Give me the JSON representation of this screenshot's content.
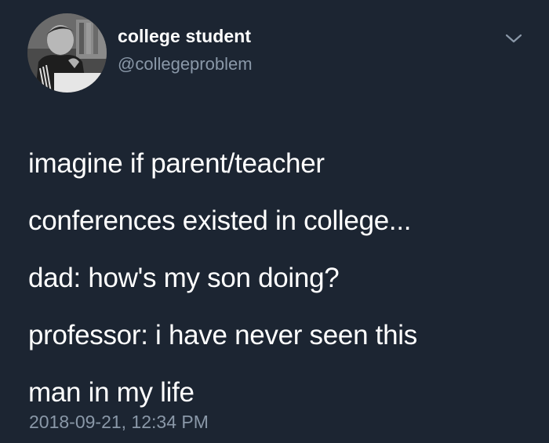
{
  "author": {
    "name": "college student",
    "handle": "@collegeproblem",
    "avatar_icon": "profile-photo-student-studying"
  },
  "menu": {
    "icon": "chevron-down-icon"
  },
  "tweet": {
    "lines": [
      "imagine if parent/teacher",
      "conferences existed in college...",
      "dad: how's my son doing?",
      "professor: i have never seen this",
      "man in my life"
    ],
    "timestamp": "2018-09-21, 12:34 PM"
  },
  "colors": {
    "background": "#1c2532",
    "text": "#ffffff",
    "secondary_text": "#8a98a8"
  }
}
